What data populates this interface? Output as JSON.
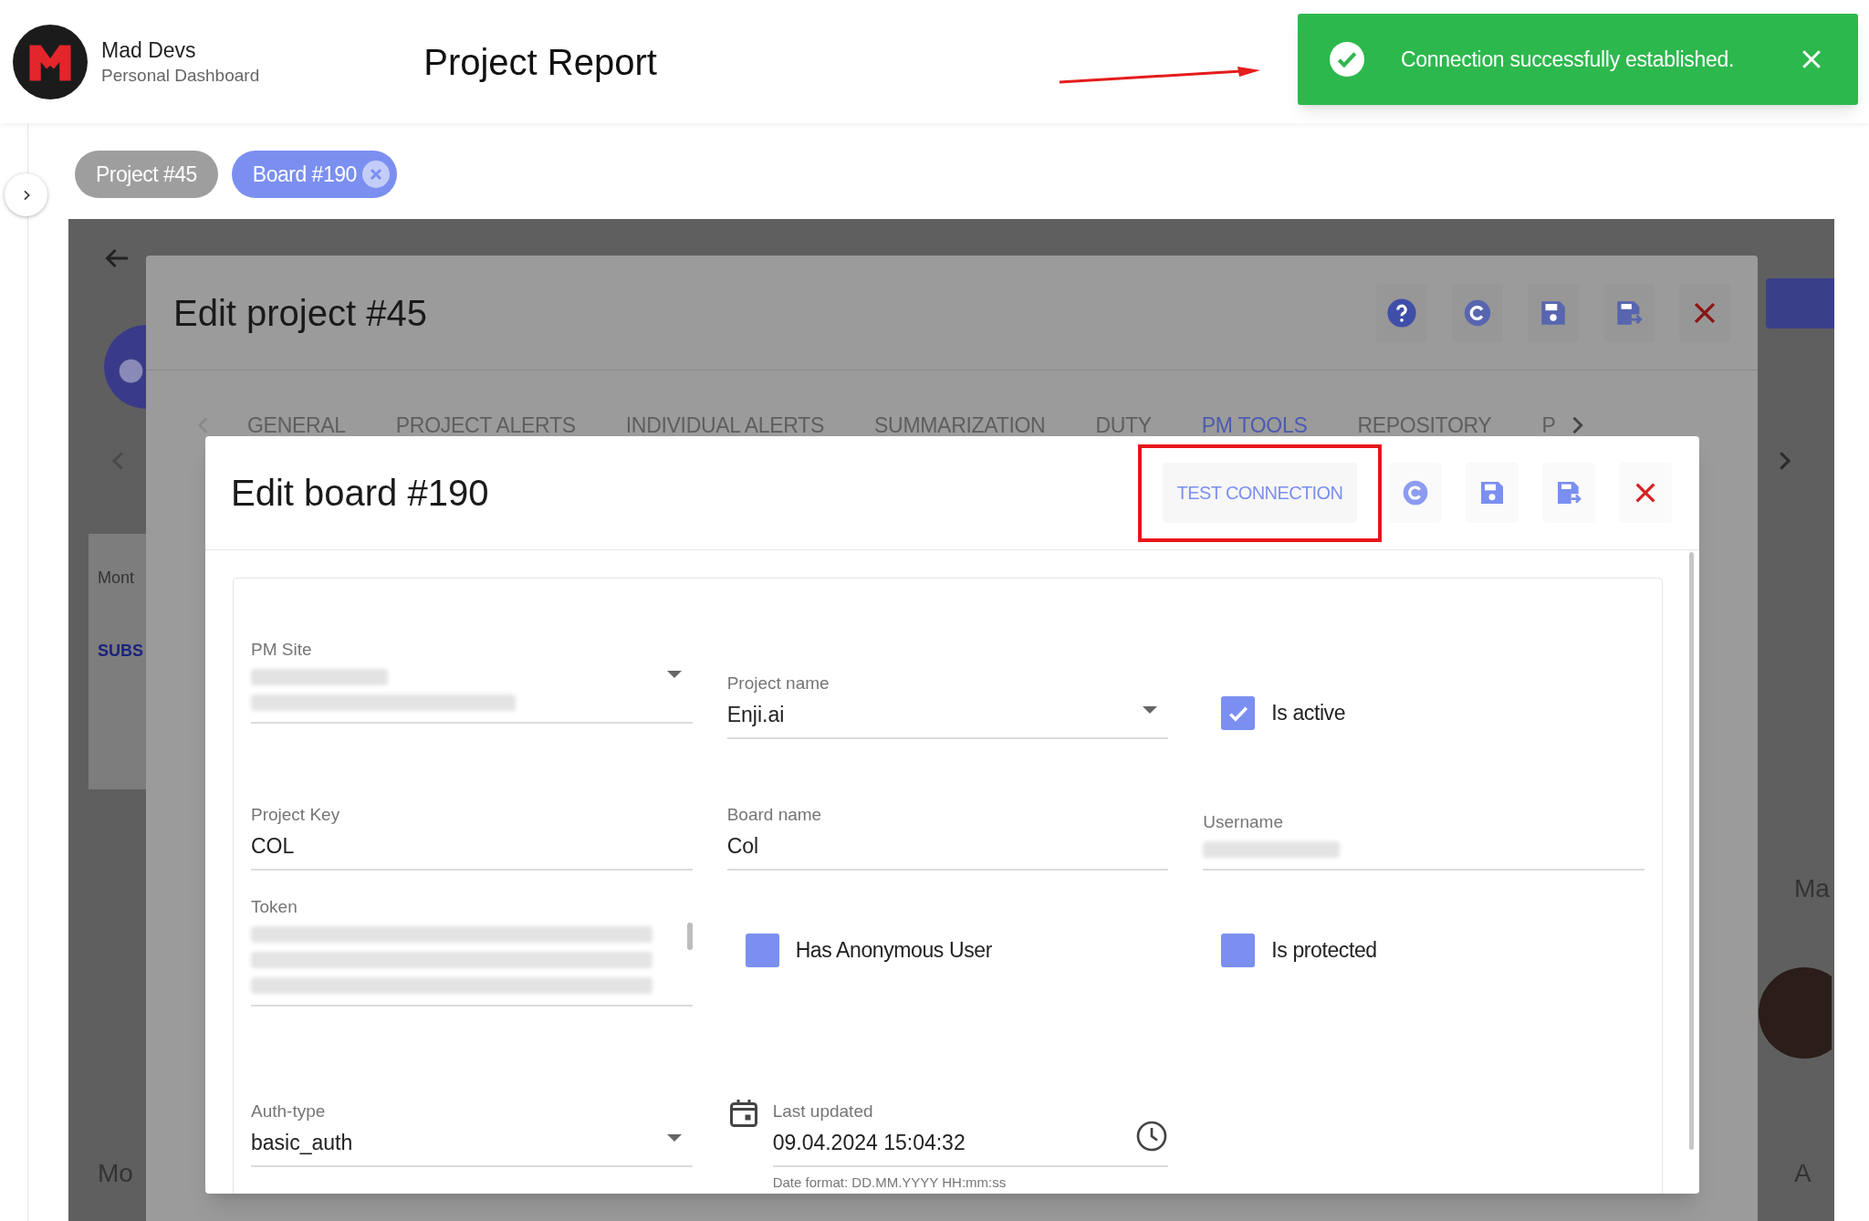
{
  "header": {
    "brand_name": "Mad Devs",
    "brand_subtitle": "Personal Dashboard",
    "title": "Project Report"
  },
  "toast": {
    "kind": "success",
    "message": "Connection successfully established."
  },
  "chips": [
    {
      "label": "Project #45",
      "selected": false
    },
    {
      "label": "Board #190",
      "selected": true
    }
  ],
  "background": {
    "left_texts": [
      "Mont",
      "SUBS",
      "Mo"
    ],
    "right_texts": [
      "Ma",
      "A"
    ]
  },
  "project_modal": {
    "title": "Edit project #45",
    "tabs": [
      {
        "label": "GENERAL",
        "selected": false
      },
      {
        "label": "PROJECT ALERTS",
        "selected": false
      },
      {
        "label": "INDIVIDUAL ALERTS",
        "selected": false
      },
      {
        "label": "SUMMARIZATION",
        "selected": false
      },
      {
        "label": "DUTY",
        "selected": false
      },
      {
        "label": "PM TOOLS",
        "selected": true
      },
      {
        "label": "REPOSITORY",
        "selected": false
      },
      {
        "label": "P",
        "selected": false
      }
    ]
  },
  "board_modal": {
    "title": "Edit board #190",
    "test_button": "TEST CONNECTION",
    "rows": [
      [
        {
          "kind": "select",
          "label": "PM Site",
          "blurred": true
        },
        {
          "kind": "select",
          "label": "Project name",
          "value": "Enji.ai"
        },
        {
          "kind": "checkbox",
          "label": "Is active",
          "checked": true
        }
      ],
      [
        {
          "kind": "text",
          "label": "Project Key",
          "value": "COL"
        },
        {
          "kind": "text",
          "label": "Board name",
          "value": "Col"
        },
        {
          "kind": "text",
          "label": "Username",
          "blurred": true
        }
      ],
      [
        {
          "kind": "textarea",
          "label": "Token",
          "blurred": true
        },
        {
          "kind": "checkbox",
          "label": "Has Anonymous User",
          "checked": false
        },
        {
          "kind": "checkbox",
          "label": "Is protected",
          "checked": false
        }
      ],
      [
        {
          "kind": "select",
          "label": "Auth-type",
          "value": "basic_auth"
        },
        {
          "kind": "datetime",
          "label": "Last updated",
          "value": "09.04.2024 15:04:32",
          "helper": "Date format: DD.MM.YYYY HH:mm:ss"
        }
      ]
    ]
  }
}
